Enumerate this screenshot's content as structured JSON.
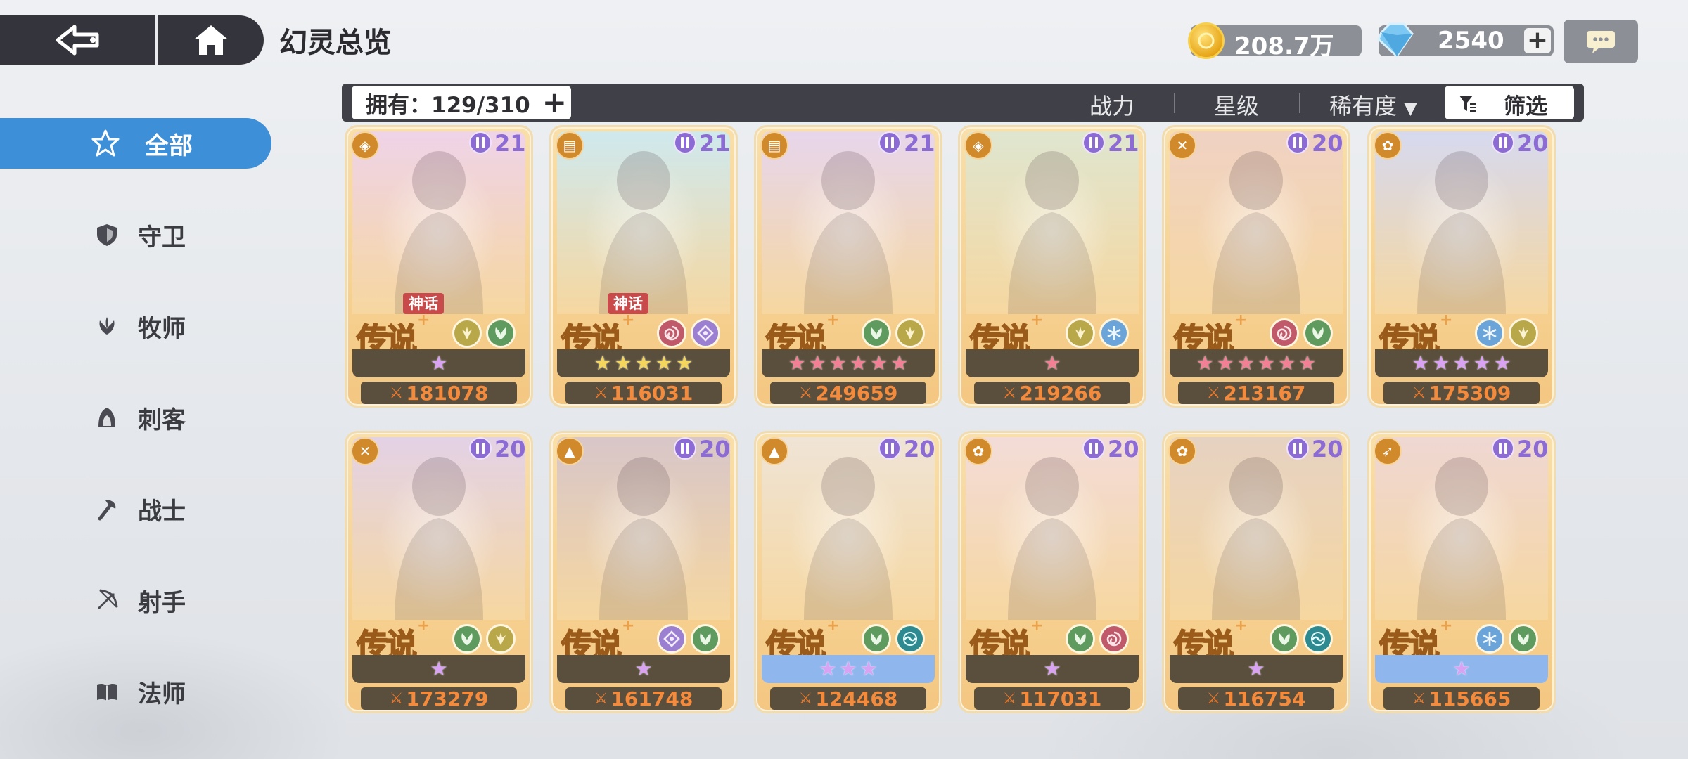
{
  "header": {
    "title": "幻灵总览",
    "gold": "208.7万",
    "gems": "2540"
  },
  "sidebar": {
    "items": [
      {
        "label": "全部",
        "icon": "star-burst-icon",
        "active": true
      },
      {
        "label": "守卫",
        "icon": "shield-icon"
      },
      {
        "label": "牧师",
        "icon": "lotus-icon"
      },
      {
        "label": "刺客",
        "icon": "hood-icon"
      },
      {
        "label": "战士",
        "icon": "axe-icon"
      },
      {
        "label": "射手",
        "icon": "bow-icon"
      },
      {
        "label": "法师",
        "icon": "book-icon"
      }
    ]
  },
  "filter": {
    "owned": "拥有：129/310",
    "sort_power": "战力",
    "sort_star": "星级",
    "sort_rarity": "稀有度",
    "rarity_arrow": "▼",
    "filter_label": "筛选"
  },
  "cards": [
    {
      "level": "21",
      "rarity": "传说",
      "tag": "神话",
      "stars": 1,
      "star_color": "purple",
      "power": "181078",
      "class_icon": "shield-icon",
      "elements": [
        "wing",
        "leaf"
      ],
      "bg": "#efd3e8"
    },
    {
      "level": "21",
      "rarity": "传说",
      "tag": "神话",
      "stars": 5,
      "star_color": "gold",
      "power": "116031",
      "class_icon": "book-icon",
      "elements": [
        "swirl",
        "gem"
      ],
      "bg": "#cfe9ee"
    },
    {
      "level": "21",
      "rarity": "传说",
      "tag": "",
      "stars": 6,
      "star_color": "pink",
      "power": "249659",
      "class_icon": "book-icon",
      "elements": [
        "leaf",
        "wing"
      ],
      "bg": "#e7d6ec"
    },
    {
      "level": "21",
      "rarity": "传说",
      "tag": "",
      "stars": 1,
      "star_color": "pink",
      "power": "219266",
      "class_icon": "shield-icon",
      "elements": [
        "wing",
        "ice"
      ],
      "bg": "#dfe6d0"
    },
    {
      "level": "20",
      "rarity": "传说",
      "tag": "",
      "stars": 6,
      "star_color": "pink",
      "power": "213167",
      "class_icon": "axe-icon",
      "elements": [
        "swirl",
        "leaf"
      ],
      "bg": "#f0d2c4"
    },
    {
      "level": "20",
      "rarity": "传说",
      "tag": "",
      "stars": 5,
      "star_color": "purple",
      "power": "175309",
      "class_icon": "lotus-icon",
      "elements": [
        "ice",
        "wing"
      ],
      "bg": "#d6d9ef"
    },
    {
      "level": "20",
      "rarity": "传说",
      "tag": "",
      "stars": 1,
      "star_color": "purple",
      "power": "173279",
      "class_icon": "axe-icon",
      "elements": [
        "leaf",
        "wing"
      ],
      "bg": "#e3d2e6"
    },
    {
      "level": "20",
      "rarity": "传说",
      "tag": "",
      "stars": 1,
      "star_color": "purple",
      "power": "161748",
      "class_icon": "hood-icon",
      "elements": [
        "gem",
        "leaf"
      ],
      "bg": "#d8c6c9"
    },
    {
      "level": "20",
      "rarity": "传说",
      "tag": "",
      "stars": 3,
      "star_color": "purple",
      "power": "124468",
      "class_icon": "hood-icon",
      "elements": [
        "leaf",
        "water"
      ],
      "bg": "#efe4d6",
      "strip": "blue"
    },
    {
      "level": "20",
      "rarity": "传说",
      "tag": "",
      "stars": 1,
      "star_color": "purple",
      "power": "117031",
      "class_icon": "lotus-icon",
      "elements": [
        "leaf",
        "swirl"
      ],
      "bg": "#f3dcd8"
    },
    {
      "level": "20",
      "rarity": "传说",
      "tag": "",
      "stars": 1,
      "star_color": "purple",
      "power": "116754",
      "class_icon": "lotus-icon",
      "elements": [
        "leaf",
        "water"
      ],
      "bg": "#e6d2c2"
    },
    {
      "level": "20",
      "rarity": "传说",
      "tag": "",
      "stars": 1,
      "star_color": "purple",
      "power": "115665",
      "class_icon": "bow-icon",
      "elements": [
        "ice",
        "leaf"
      ],
      "bg": "#efd7d3",
      "strip": "blue"
    }
  ]
}
